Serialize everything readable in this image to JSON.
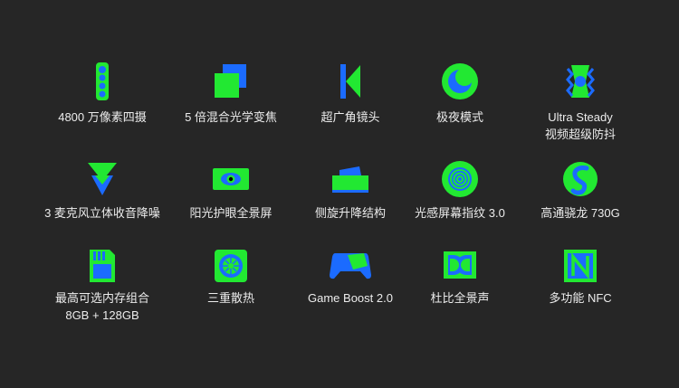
{
  "colors": {
    "background": "#262626",
    "green": "#22e832",
    "blue": "#1b6bff",
    "text": "#ececec"
  },
  "features": [
    {
      "icon": "quad-camera-icon",
      "lines": [
        "4800 万像素四摄"
      ]
    },
    {
      "icon": "hybrid-zoom-icon",
      "lines": [
        "5 倍混合光学变焦"
      ]
    },
    {
      "icon": "ultra-wide-icon",
      "lines": [
        "超广角镜头"
      ]
    },
    {
      "icon": "night-mode-icon",
      "lines": [
        "极夜模式"
      ]
    },
    {
      "icon": "steady-video-icon",
      "lines": [
        "Ultra Steady",
        "视频超级防抖"
      ]
    },
    {
      "icon": "stereo-speaker-icon",
      "lines": [
        "3 麦克风立体收音降噪"
      ]
    },
    {
      "icon": "eye-care-screen-icon",
      "lines": [
        "阳光护眼全景屏"
      ]
    },
    {
      "icon": "pop-up-camera-icon",
      "lines": [
        "侧旋升降结构"
      ]
    },
    {
      "icon": "fingerprint-icon",
      "lines": [
        "光感屏幕指纹 3.0"
      ]
    },
    {
      "icon": "snapdragon-icon",
      "lines": [
        "高通骁龙 730G"
      ]
    },
    {
      "icon": "memory-card-icon",
      "lines": [
        "最高可选内存组合",
        "8GB + 128GB"
      ]
    },
    {
      "icon": "cooling-fan-icon",
      "lines": [
        "三重散热"
      ]
    },
    {
      "icon": "gamepad-icon",
      "lines": [
        "Game Boost 2.0"
      ]
    },
    {
      "icon": "dolby-icon",
      "lines": [
        "杜比全景声"
      ]
    },
    {
      "icon": "nfc-icon",
      "lines": [
        "多功能 NFC"
      ]
    }
  ]
}
